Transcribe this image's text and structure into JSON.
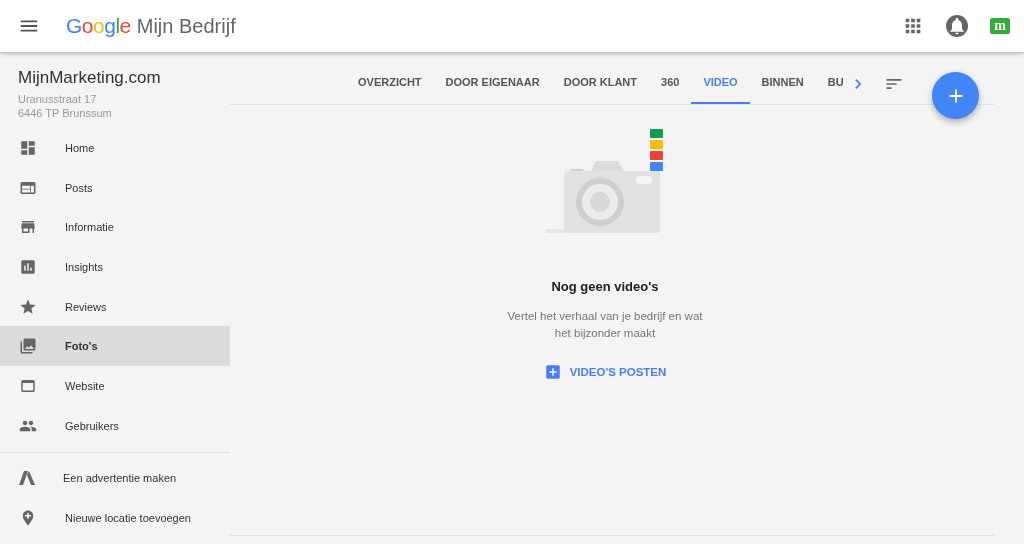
{
  "header": {
    "logo": "Google",
    "product": "Mijn Bedrijf",
    "avatar_letter": "m"
  },
  "business": {
    "name": "MijnMarketing.com",
    "address_lines": [
      "Uranusstraat 17",
      "6446 TP Brunssum"
    ]
  },
  "sidebar": {
    "items": [
      {
        "label": "Home",
        "selected": false
      },
      {
        "label": "Posts",
        "selected": false
      },
      {
        "label": "Informatie",
        "selected": false
      },
      {
        "label": "Insights",
        "selected": false
      },
      {
        "label": "Reviews",
        "selected": false
      },
      {
        "label": "Foto's",
        "selected": true
      },
      {
        "label": "Website",
        "selected": false
      },
      {
        "label": "Gebruikers",
        "selected": false
      }
    ],
    "extra_items": [
      {
        "label": "Een advertentie maken"
      },
      {
        "label": "Nieuwe locatie toevoegen"
      }
    ]
  },
  "tabs": [
    {
      "label": "OVERZICHT",
      "selected": false
    },
    {
      "label": "DOOR EIGENAAR",
      "selected": false
    },
    {
      "label": "DOOR KLANT",
      "selected": false
    },
    {
      "label": "360",
      "selected": false
    },
    {
      "label": "VIDEO",
      "selected": true
    },
    {
      "label": "BINNEN",
      "selected": false
    },
    {
      "label": "BU",
      "selected": false
    }
  ],
  "empty_state": {
    "title": "Nog geen video's",
    "description": "Vertel het verhaal van je bedrijf en wat het bijzonder maakt",
    "action": "VIDEO'S POSTEN"
  }
}
